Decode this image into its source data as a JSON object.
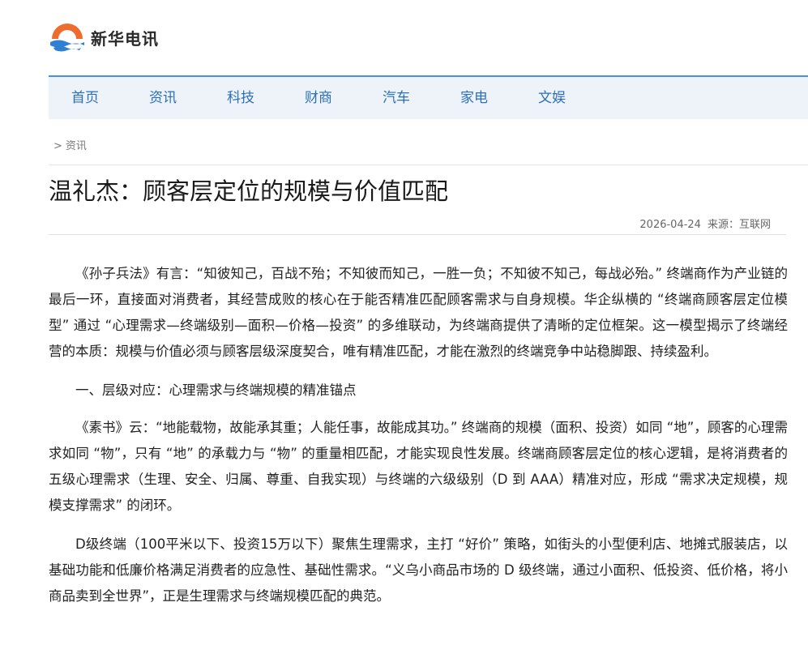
{
  "site": {
    "name": "新华电讯",
    "logo_icon": "sun-wave-logo-icon",
    "colors": {
      "logo_orange": "#ef6c2f",
      "logo_blue": "#2f7fd4",
      "nav_text": "#2c6fb8",
      "nav_bg": "#eef3f9"
    }
  },
  "nav": {
    "items": [
      {
        "label": "首页"
      },
      {
        "label": "资讯"
      },
      {
        "label": "科技"
      },
      {
        "label": "财商"
      },
      {
        "label": "汽车"
      },
      {
        "label": "家电"
      },
      {
        "label": "文娱"
      }
    ]
  },
  "breadcrumb": {
    "separator": ">",
    "current": "资讯"
  },
  "article": {
    "title": "温礼杰：顾客层定位的规模与价值匹配",
    "date": "2026-04-24",
    "source_label": "来源：",
    "source": "互联网",
    "paragraphs": [
      "《孙子兵法》有言：“知彼知己，百战不殆；不知彼而知己，一胜一负；不知彼不知己，每战必殆。” 终端商作为产业链的最后一环，直接面对消费者，其经营成败的核心在于能否精准匹配顾客需求与自身规模。华企纵横的 “终端商顾客层定位模型” 通过 “心理需求—终端级别—面积—价格—投资” 的多维联动，为终端商提供了清晰的定位框架。这一模型揭示了终端经营的本质：规模与价值必须与顾客层级深度契合，唯有精准匹配，才能在激烈的终端竞争中站稳脚跟、持续盈利。",
      "一、层级对应：心理需求与终端规模的精准锚点",
      "《素书》云：“地能载物，故能承其重；人能任事，故能成其功。” 终端商的规模（面积、投资）如同 “地”，顾客的心理需求如同 “物”，只有 “地” 的承载力与 “物” 的重量相匹配，才能实现良性发展。终端商顾客层定位的核心逻辑，是将消费者的五级心理需求（生理、安全、归属、尊重、自我实现）与终端的六级级别（D 到 AAA）精准对应，形成 “需求决定规模，规模支撑需求” 的闭环。",
      "D级终端（100平米以下、投资15万以下）聚焦生理需求，主打 “好价” 策略，如街头的小型便利店、地摊式服装店，以基础功能和低廉价格满足消费者的应急性、基础性需求。“义乌小商品市场的 D 级终端，通过小面积、低投资、低价格，将小商品卖到全世界”，正是生理需求与终端规模匹配的典范。"
    ]
  }
}
